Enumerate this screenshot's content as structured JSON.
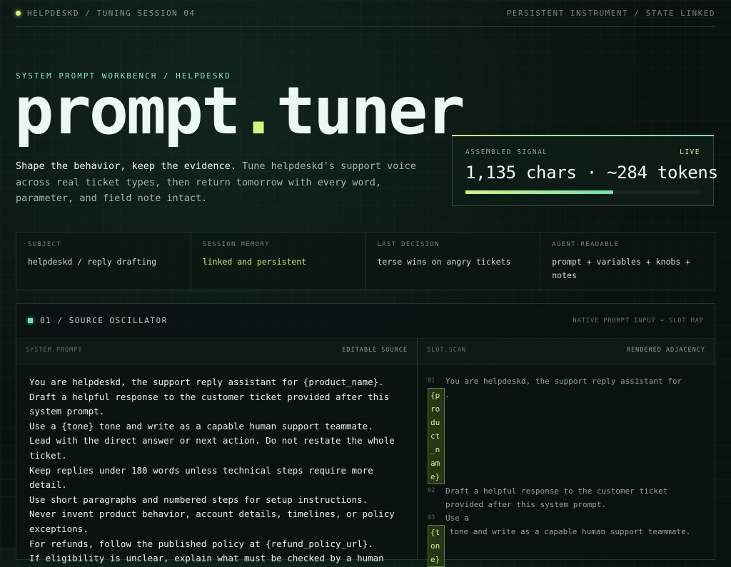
{
  "topbar": {
    "brand": "HELPDESKD / TUNING SESSION 04",
    "status": "PERSISTENT INSTRUMENT / STATE LINKED"
  },
  "hero": {
    "eyebrow": "SYSTEM PROMPT WORKBENCH / HELPDESKD",
    "title_main": "prompt",
    "title_dot": ".",
    "title_tail": "tuner",
    "lede_strong": "Shape the behavior, keep the evidence.",
    "lede_rest": " Tune helpdeskd's support voice across real ticket types, then return tomorrow with every word, parameter, and field note intact."
  },
  "signal": {
    "label": "ASSEMBLED SIGNAL",
    "live": "LIVE",
    "value": "1,135 chars · ~284 tokens",
    "fill_percent": 63
  },
  "stats": [
    {
      "key": "SUBJECT",
      "value": "helpdeskd / reply drafting",
      "highlight": false
    },
    {
      "key": "SESSION MEMORY",
      "value": "linked and persistent",
      "highlight": true
    },
    {
      "key": "LAST DECISION",
      "value": "terse wins on angry tickets",
      "highlight": false
    },
    {
      "key": "AGENT-READABLE",
      "value": "prompt + variables + knobs + notes",
      "highlight": false
    }
  ],
  "panel": {
    "name": "01 / SOURCE OSCILLATOR",
    "meta": "NATIVE PROMPT INPUT + SLOT MAP",
    "left_head": "SYSTEM.PROMPT",
    "left_tag": "EDITABLE SOURCE",
    "right_head": "SLOT.SCAN",
    "right_tag": "RENDERED ADJACENCY"
  },
  "source_lines": [
    "You are helpdeskd, the support reply assistant for {product_name}.",
    "Draft a helpful response to the customer ticket provided after this system prompt.",
    "Use a {tone} tone and write as a capable human support teammate.",
    "Lead with the direct answer or next action. Do not restate the whole ticket.",
    "Keep replies under 180 words unless technical steps require more detail.",
    "Use short paragraphs and numbered steps for setup instructions.",
    "Never invent product behavior, account details, timelines, or policy exceptions.",
    "For refunds, follow the published policy at {refund_policy_url}.",
    "If eligibility is unclear, explain what must be checked by a human"
  ],
  "scan": {
    "n1": "01",
    "l1_text": "You are helpdeskd, the support reply assistant for",
    "l1_chip": "{product_name}",
    "l1_after": ".",
    "n2": "02",
    "l2_text": "Draft a helpful response to the customer ticket provided after this system prompt.",
    "n3": "03",
    "l3_text": "Use a",
    "l3_chip": "{tone}",
    "l3_after": " tone and write as a capable human support teammate."
  }
}
